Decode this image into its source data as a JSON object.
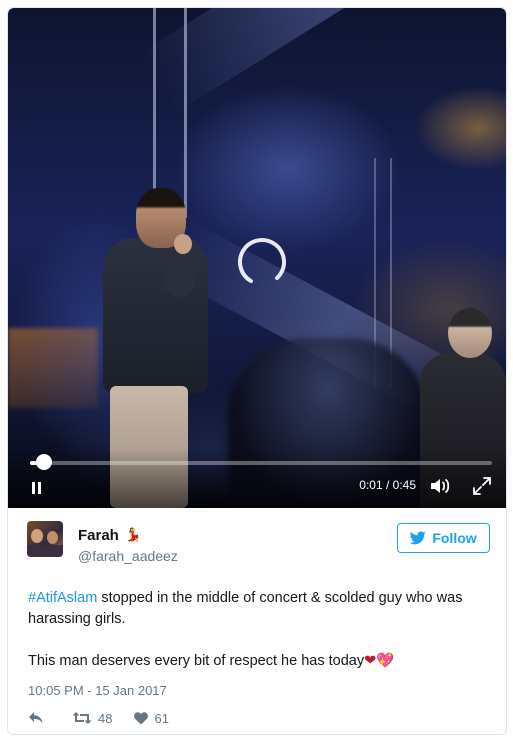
{
  "video": {
    "current_time": "0:01",
    "duration": "0:45",
    "time_display": "0:01 / 0:45",
    "progress_fraction": 0.03
  },
  "author": {
    "name": "Farah",
    "name_emoji": "💃",
    "handle": "@farah_aadeez"
  },
  "follow": {
    "label": "Follow"
  },
  "tweet": {
    "hashtag": "#AtifAslam",
    "text_line1_rest": " stopped in the middle of concert & scolded guy who was harassing girls.",
    "text_line2": "This man deserves every bit of respect he has today",
    "text_emojis": "❤💖",
    "timestamp": "10:05 PM - 15 Jan 2017"
  },
  "stats": {
    "retweets": "48",
    "likes": "61"
  },
  "colors": {
    "accent": "#1da1f2",
    "link": "#1b95e0",
    "muted": "#657786",
    "border": "#e1e8ed"
  },
  "icons": [
    "pause-icon",
    "volume-icon",
    "fullscreen-icon",
    "loading-spinner-icon",
    "twitter-bird-icon",
    "reply-icon",
    "retweet-icon",
    "heart-icon"
  ]
}
